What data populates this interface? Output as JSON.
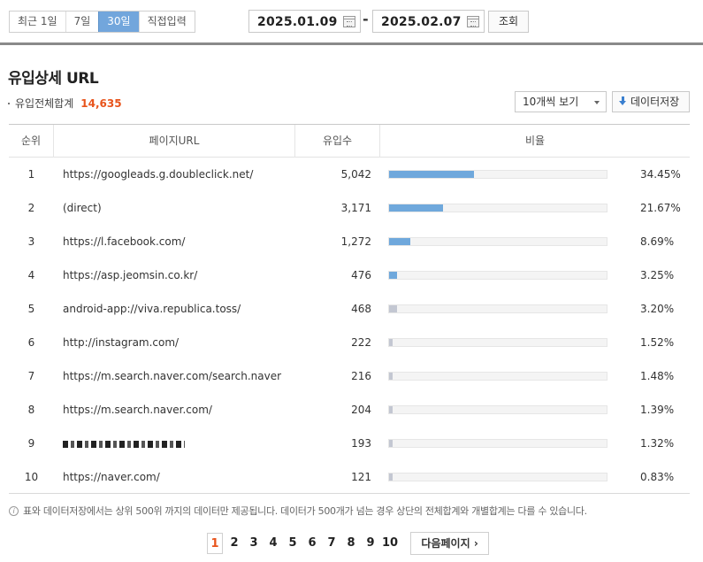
{
  "toolbar": {
    "range_buttons": [
      {
        "label": "최근 1일",
        "active": false
      },
      {
        "label": "7일",
        "active": false
      },
      {
        "label": "30일",
        "active": true
      },
      {
        "label": "직접입력",
        "active": false
      }
    ],
    "start_date": "2025.01.09",
    "end_date": "2025.02.07",
    "date_separator": "-",
    "query_label": "조회"
  },
  "section": {
    "title": "유입상세 URL",
    "total_label": "유입전체합계",
    "total_value": "14,635",
    "per_page": "10개씩 보기",
    "save_label": "데이터저장"
  },
  "table": {
    "headers": [
      "순위",
      "페이지URL",
      "유입수",
      "비율"
    ],
    "rows": [
      {
        "rank": "1",
        "url": "https://googleads.g.doubleclick.net/",
        "count": "5,042",
        "pct": "34.45%",
        "ratio": 34.45
      },
      {
        "rank": "2",
        "url": "(direct)",
        "count": "3,171",
        "pct": "21.67%",
        "ratio": 21.67
      },
      {
        "rank": "3",
        "url": "https://l.facebook.com/",
        "count": "1,272",
        "pct": "8.69%",
        "ratio": 8.69
      },
      {
        "rank": "4",
        "url": "https://asp.jeomsin.co.kr/",
        "count": "476",
        "pct": "3.25%",
        "ratio": 3.25
      },
      {
        "rank": "5",
        "url": "android-app://viva.republica.toss/",
        "count": "468",
        "pct": "3.20%",
        "ratio": 3.2
      },
      {
        "rank": "6",
        "url": "http://instagram.com/",
        "count": "222",
        "pct": "1.52%",
        "ratio": 1.52
      },
      {
        "rank": "7",
        "url": "https://m.search.naver.com/search.naver",
        "count": "216",
        "pct": "1.48%",
        "ratio": 1.48
      },
      {
        "rank": "8",
        "url": "https://m.search.naver.com/",
        "count": "204",
        "pct": "1.39%",
        "ratio": 1.39
      },
      {
        "rank": "9",
        "url": "",
        "count": "193",
        "pct": "1.32%",
        "ratio": 1.32
      },
      {
        "rank": "10",
        "url": "https://naver.com/",
        "count": "121",
        "pct": "0.83%",
        "ratio": 0.83
      }
    ]
  },
  "note": "표와 데이터저장에서는 상위 500위 까지의 데이터만 제공됩니다. 데이터가 500개가 넘는 경우 상단의 전체합계와 개별합계는 다를 수 있습니다.",
  "pagination": {
    "pages": [
      "1",
      "2",
      "3",
      "4",
      "5",
      "6",
      "7",
      "8",
      "9",
      "10"
    ],
    "current": "1",
    "next_label": "다음페이지"
  },
  "colors": {
    "active_tab": "#72a6dc",
    "bar_strong": "#6fa8dc",
    "bar_weak": "#c3c7d2",
    "total_highlight": "#e8541c"
  }
}
